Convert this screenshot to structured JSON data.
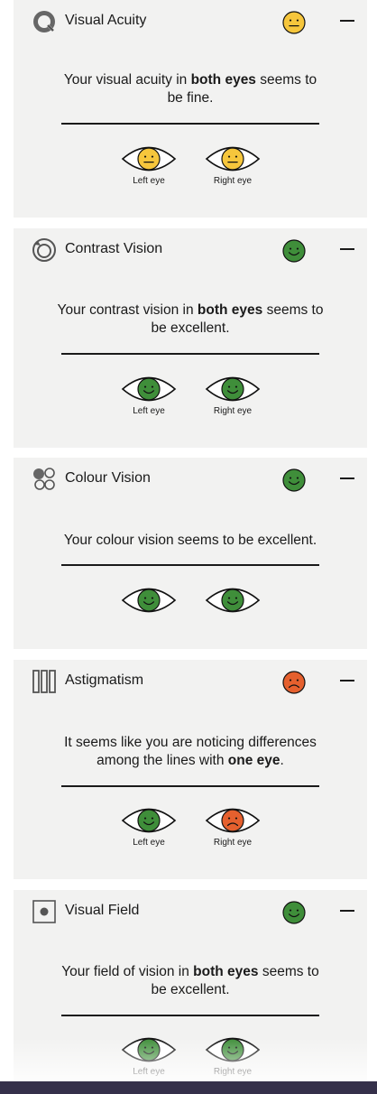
{
  "colors": {
    "neutral": "#f6c63c",
    "good": "#3f8e3a",
    "bad": "#e5602e",
    "card_bg": "#f2f2f1",
    "bottom_bar": "#35304a"
  },
  "cards": [
    {
      "title": "Visual Acuity",
      "icon": "visual-acuity-icon",
      "status": "neutral",
      "summary": {
        "pre": "Your visual acuity in ",
        "bold": "both eyes",
        "post": " seems to be fine."
      },
      "eyes": [
        {
          "label": "Left eye",
          "status": "neutral"
        },
        {
          "label": "Right eye",
          "status": "neutral"
        }
      ]
    },
    {
      "title": "Contrast Vision",
      "icon": "contrast-vision-icon",
      "status": "good",
      "summary": {
        "pre": "Your contrast vision in ",
        "bold": "both eyes",
        "post": " seems to be excellent."
      },
      "eyes": [
        {
          "label": "Left eye",
          "status": "good"
        },
        {
          "label": "Right eye",
          "status": "good"
        }
      ]
    },
    {
      "title": "Colour Vision",
      "icon": "colour-vision-icon",
      "status": "good",
      "summary": {
        "pre": "Your colour vision seems to be excellent.",
        "bold": "",
        "post": ""
      },
      "eyes": [
        {
          "label": "",
          "status": "good"
        },
        {
          "label": "",
          "status": "good"
        }
      ]
    },
    {
      "title": "Astigmatism",
      "icon": "astigmatism-icon",
      "status": "bad",
      "summary": {
        "pre": "It seems like you are noticing differences among the lines with ",
        "bold": "one eye",
        "post": "."
      },
      "eyes": [
        {
          "label": "Left eye",
          "status": "good"
        },
        {
          "label": "Right eye",
          "status": "bad"
        }
      ]
    },
    {
      "title": "Visual Field",
      "icon": "visual-field-icon",
      "status": "good",
      "summary": {
        "pre": "Your field of vision in ",
        "bold": "both eyes",
        "post": " seems to be excellent."
      },
      "eyes": [
        {
          "label": "Left eye",
          "status": "good"
        },
        {
          "label": "Right eye",
          "status": "good"
        }
      ]
    }
  ]
}
